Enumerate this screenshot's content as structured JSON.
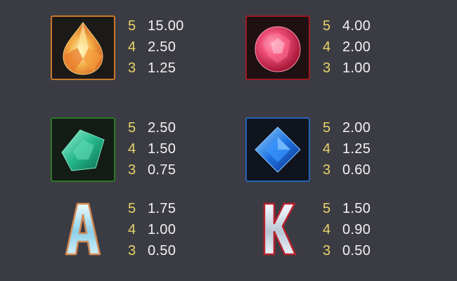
{
  "paytable": [
    {
      "symbol": "orange-drop-gem-icon",
      "accent": "#d9842a",
      "payouts": [
        {
          "count": "5",
          "value": "15.00"
        },
        {
          "count": "4",
          "value": "2.50"
        },
        {
          "count": "3",
          "value": "1.25"
        }
      ]
    },
    {
      "symbol": "red-round-gem-icon",
      "accent": "#b31b22",
      "payouts": [
        {
          "count": "5",
          "value": "4.00"
        },
        {
          "count": "4",
          "value": "2.00"
        },
        {
          "count": "3",
          "value": "1.00"
        }
      ]
    },
    {
      "symbol": "green-gem-icon",
      "accent": "#2e8a2a",
      "payouts": [
        {
          "count": "5",
          "value": "2.50"
        },
        {
          "count": "4",
          "value": "1.50"
        },
        {
          "count": "3",
          "value": "0.75"
        }
      ]
    },
    {
      "symbol": "blue-square-gem-icon",
      "accent": "#2a6fcf",
      "payouts": [
        {
          "count": "5",
          "value": "2.00"
        },
        {
          "count": "4",
          "value": "1.25"
        },
        {
          "count": "3",
          "value": "0.60"
        }
      ]
    },
    {
      "symbol": "letter-a-icon",
      "accent": "#d28a55",
      "payouts": [
        {
          "count": "5",
          "value": "1.75"
        },
        {
          "count": "4",
          "value": "1.00"
        },
        {
          "count": "3",
          "value": "0.50"
        }
      ]
    },
    {
      "symbol": "letter-k-icon",
      "accent": "#b8212b",
      "payouts": [
        {
          "count": "5",
          "value": "1.50"
        },
        {
          "count": "4",
          "value": "0.90"
        },
        {
          "count": "3",
          "value": "0.50"
        }
      ]
    }
  ]
}
